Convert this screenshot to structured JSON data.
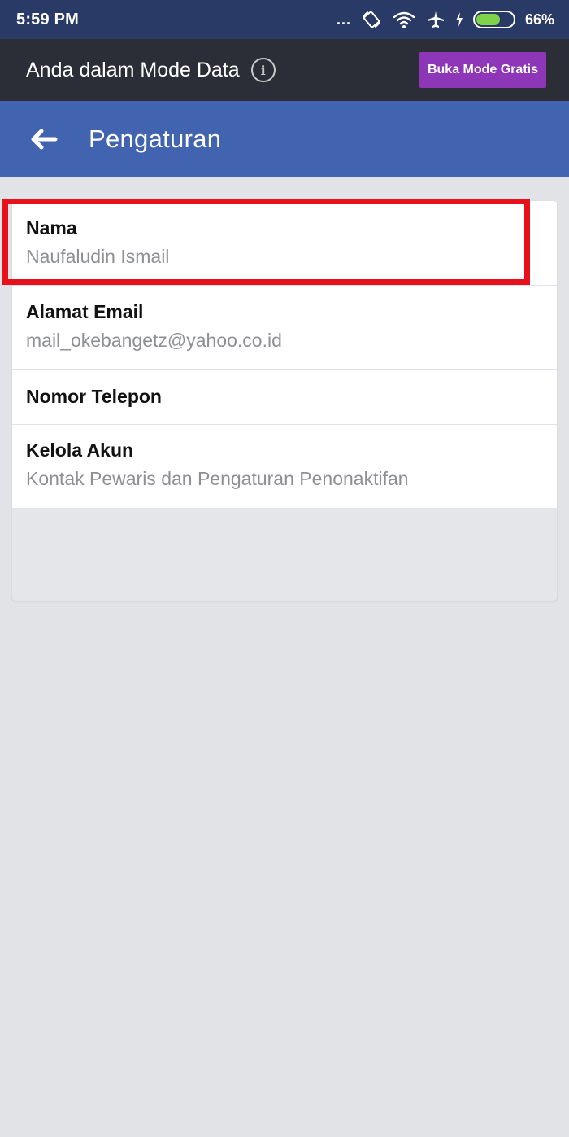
{
  "status_bar": {
    "time": "5:59 PM",
    "dots": "...",
    "battery_percent": "66%",
    "battery_level": 0.66
  },
  "data_mode_bar": {
    "message": "Anda dalam Mode Data",
    "info_icon": "info-icon",
    "button_label": "Buka Mode Gratis"
  },
  "header": {
    "back_icon": "arrow-left-icon",
    "title": "Pengaturan"
  },
  "settings": {
    "items": [
      {
        "title": "Nama",
        "value": "Naufaludin Ismail"
      },
      {
        "title": "Alamat Email",
        "value": "mail_okebangetz@yahoo.co.id"
      },
      {
        "title": "Nomor Telepon",
        "value": ""
      },
      {
        "title": "Kelola Akun",
        "value": "Kontak Pewaris dan Pengaturan Penonaktifan"
      }
    ]
  },
  "colors": {
    "status_bar": "#2a3a66",
    "data_bar": "#2b2e36",
    "header": "#4263b0",
    "button": "#8e36b8",
    "highlight": "#e8101b",
    "background": "#e2e3e7"
  }
}
